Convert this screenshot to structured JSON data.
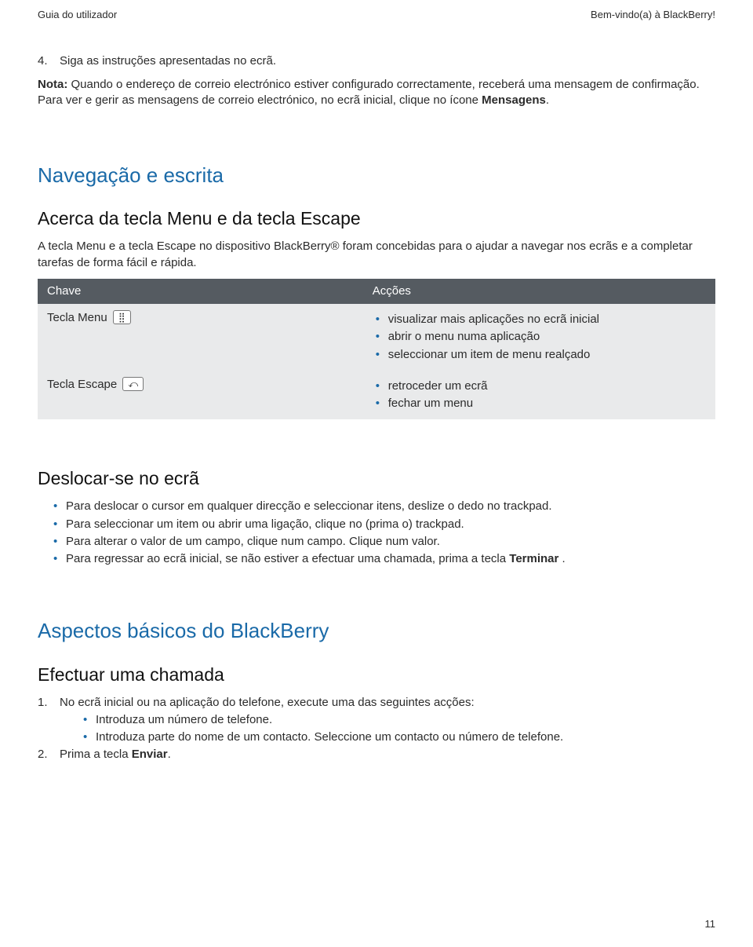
{
  "header": {
    "left": "Guia do utilizador",
    "right": "Bem-vindo(a) à BlackBerry!"
  },
  "step4": {
    "num": "4.",
    "text": "Siga as instruções apresentadas no ecrã."
  },
  "note": {
    "label": "Nota:",
    "part1": "Quando o endereço de correio electrónico estiver configurado correctamente, receberá uma mensagem de confirmação. Para ver e gerir as mensagens de correio electrónico, no ecrã inicial, clique no ícone ",
    "bold": "Mensagens",
    "part2": "."
  },
  "section1": {
    "title": "Navegação e escrita",
    "sub1": "Acerca da tecla Menu e da tecla Escape",
    "intro": "A tecla Menu e a tecla Escape no dispositivo BlackBerry® foram concebidas para o ajudar a navegar nos ecrãs e a completar tarefas de forma fácil e rápida.",
    "table": {
      "h1": "Chave",
      "h2": "Acções",
      "row1_label": "Tecla Menu",
      "row1_icon": "⣿",
      "row1_items": [
        "visualizar mais aplicações no ecrã inicial",
        "abrir o menu numa aplicação",
        "seleccionar um item de menu realçado"
      ],
      "row2_label": "Tecla Escape",
      "row2_icon": "⤺",
      "row2_items": [
        "retroceder um ecrã",
        "fechar um menu"
      ]
    },
    "sub2": "Deslocar-se no ecrã",
    "list2": [
      "Para deslocar o cursor em qualquer direcção e seleccionar itens, deslize o dedo no trackpad.",
      "Para seleccionar um item ou abrir uma ligação, clique no (prima o) trackpad.",
      "Para alterar o valor de um campo, clique num campo. Clique num valor."
    ],
    "list2_last_pre": "Para regressar ao ecrã inicial, se não estiver a efectuar uma chamada, prima a tecla ",
    "list2_last_bold": "Terminar",
    "list2_last_post": " ."
  },
  "section2": {
    "title": "Aspectos básicos do BlackBerry",
    "sub1": "Efectuar uma chamada",
    "item1_num": "1.",
    "item1_text": "No ecrã inicial ou na aplicação do telefone, execute uma das seguintes acções:",
    "sub_items": [
      "Introduza um número de telefone.",
      "Introduza parte do nome de um contacto. Seleccione um contacto ou número de telefone."
    ],
    "item2_num": "2.",
    "item2_pre": "Prima a tecla ",
    "item2_bold": "Enviar",
    "item2_post": "."
  },
  "page": "11"
}
